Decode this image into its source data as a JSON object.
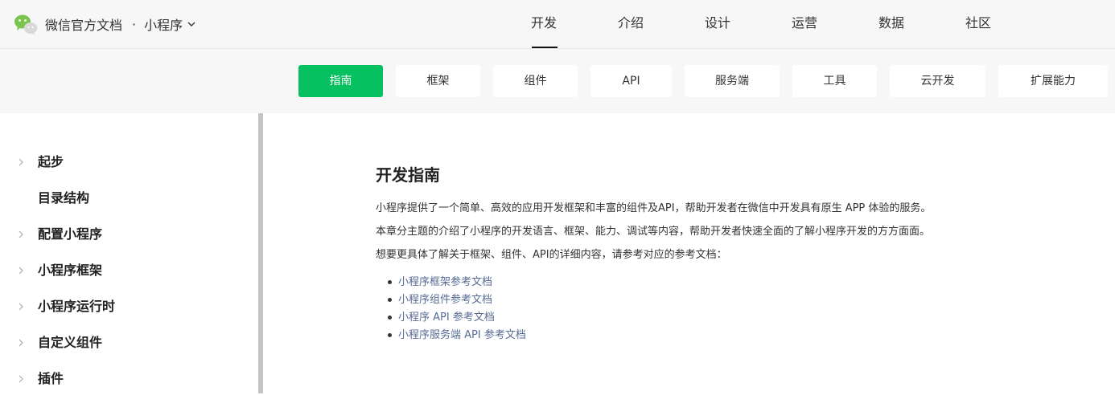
{
  "header": {
    "title": "微信官方文档",
    "separator": "·",
    "product": "小程序",
    "nav": [
      {
        "label": "开发",
        "active": true
      },
      {
        "label": "介绍",
        "active": false
      },
      {
        "label": "设计",
        "active": false
      },
      {
        "label": "运营",
        "active": false
      },
      {
        "label": "数据",
        "active": false
      },
      {
        "label": "社区",
        "active": false
      }
    ]
  },
  "sub_tabs": [
    {
      "label": "指南",
      "active": true
    },
    {
      "label": "框架",
      "active": false
    },
    {
      "label": "组件",
      "active": false
    },
    {
      "label": "API",
      "active": false
    },
    {
      "label": "服务端",
      "active": false
    },
    {
      "label": "工具",
      "active": false
    },
    {
      "label": "云开发",
      "active": false
    },
    {
      "label": "扩展能力",
      "active": false
    }
  ],
  "sidebar": {
    "items": [
      {
        "label": "起步",
        "expandable": true
      },
      {
        "label": "目录结构",
        "expandable": false
      },
      {
        "label": "配置小程序",
        "expandable": true
      },
      {
        "label": "小程序框架",
        "expandable": true
      },
      {
        "label": "小程序运行时",
        "expandable": true
      },
      {
        "label": "自定义组件",
        "expandable": true
      },
      {
        "label": "插件",
        "expandable": true
      }
    ]
  },
  "content": {
    "title": "开发指南",
    "paragraphs": [
      "小程序提供了一个简单、高效的应用开发框架和丰富的组件及API，帮助开发者在微信中开发具有原生 APP 体验的服务。",
      "本章分主题的介绍了小程序的开发语言、框架、能力、调试等内容，帮助开发者快速全面的了解小程序开发的方方面面。",
      "想要更具体了解关于框架、组件、API的详细内容，请参考对应的参考文档："
    ],
    "links": [
      "小程序框架参考文档",
      "小程序组件参考文档",
      "小程序 API 参考文档",
      "小程序服务端 API 参考文档"
    ]
  },
  "colors": {
    "accent": "#07c160",
    "link": "#576b95",
    "logo": "#7bc54f"
  },
  "icons": {
    "logo": "wechat-logo-icon",
    "product_dropdown": "chevron-down-icon",
    "sidebar_expand": "chevron-right-icon"
  }
}
